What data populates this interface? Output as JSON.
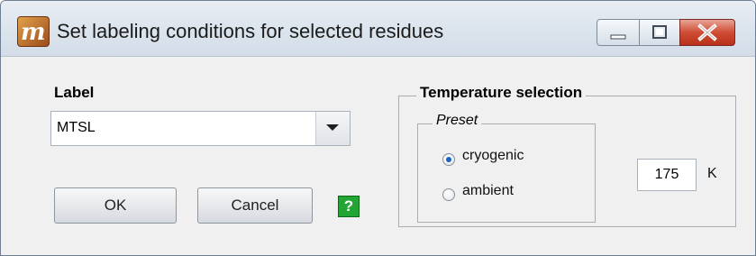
{
  "window": {
    "title": "Set labeling conditions for selected residues",
    "app_icon_letter": "m"
  },
  "caption_buttons": {
    "minimize": "minimize-icon",
    "maximize": "maximize-icon",
    "close": "close-icon"
  },
  "label_section": {
    "heading": "Label",
    "selected_value": "MTSL"
  },
  "buttons": {
    "ok": "OK",
    "cancel": "Cancel",
    "help": "?"
  },
  "temperature": {
    "heading": "Temperature selection",
    "preset_heading": "Preset",
    "options": [
      {
        "label": "cryogenic",
        "checked": true
      },
      {
        "label": "ambient",
        "checked": false
      }
    ],
    "value": "175",
    "unit": "K"
  },
  "colors": {
    "help_green": "#23a533",
    "radio_dot": "#1d63c2",
    "close_red": "#cf4d34"
  }
}
